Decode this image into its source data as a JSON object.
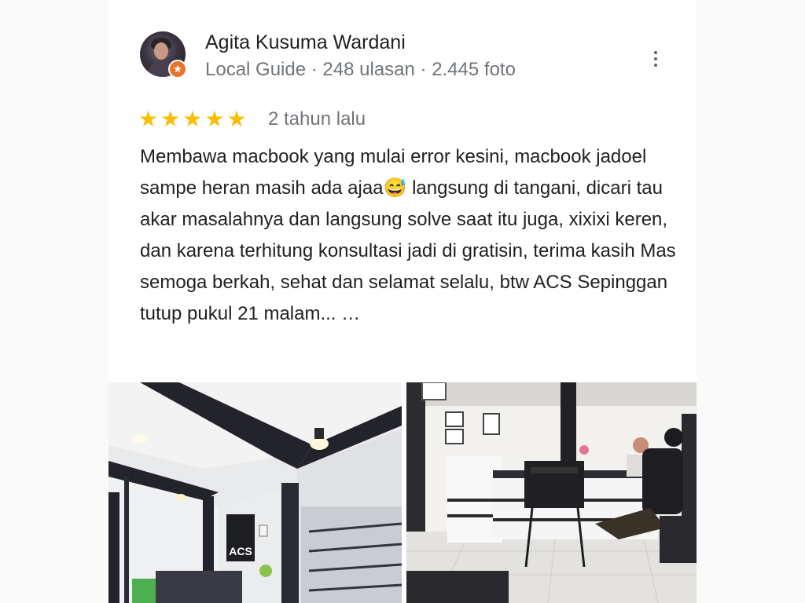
{
  "reviewer": {
    "name": "Agita Kusuma Wardani",
    "level": "Local Guide",
    "separator": " · ",
    "reviews": "248 ulasan",
    "photos": "2.445 foto"
  },
  "rating": {
    "stars": 5,
    "star_glyph": "★",
    "time_ago": "2 tahun lalu"
  },
  "review_text": "Membawa macbook yang mulai error kesini, macbook jadoel sampe heran masih ada ajaa😅 langsung di tangani, dicari tau akar masalahnya dan langsung solve saat itu juga, xixixi keren, dan karena terhitung konsultasi jadi di gratisin, terima kasih Mas semoga berkah, sehat dan selamat selalu, btw ACS Sepinggan tutup pukul 21 malam... …",
  "photo_signage": "ACS",
  "icons": {
    "badge": "local-guide-badge-icon",
    "menu": "more-vert-icon",
    "star": "star-icon"
  },
  "colors": {
    "star": "#fbbc04",
    "badge": "#e8742e",
    "name": "#202124",
    "meta": "#70757a"
  }
}
